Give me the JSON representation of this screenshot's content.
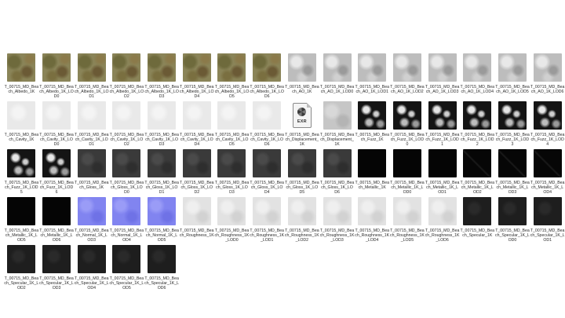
{
  "files": [
    {
      "name": "T_00715_MD_Beach_Albedo_1K",
      "kind": "albedo"
    },
    {
      "name": "T_00715_MD_Beach_Albedo_1K_LOD0",
      "kind": "albedo"
    },
    {
      "name": "T_00715_MD_Beach_Albedo_1K_LOD1",
      "kind": "albedo"
    },
    {
      "name": "T_00715_MD_Beach_Albedo_1K_LOD2",
      "kind": "albedo"
    },
    {
      "name": "T_00715_MD_Beach_Albedo_1K_LOD3",
      "kind": "albedo"
    },
    {
      "name": "T_00715_MD_Beach_Albedo_1K_LOD4",
      "kind": "albedo"
    },
    {
      "name": "T_00715_MD_Beach_Albedo_1K_LOD5",
      "kind": "albedo"
    },
    {
      "name": "T_00715_MD_Beach_Albedo_1K_LOD6",
      "kind": "albedo"
    },
    {
      "name": "T_00715_MD_Beach_AO_1K",
      "kind": "ao"
    },
    {
      "name": "T_00715_MD_Beach_AO_1K_LOD0",
      "kind": "ao"
    },
    {
      "name": "T_00715_MD_Beach_AO_1K_LOD1",
      "kind": "ao"
    },
    {
      "name": "T_00715_MD_Beach_AO_1K_LOD2",
      "kind": "ao"
    },
    {
      "name": "T_00715_MD_Beach_AO_1K_LOD3",
      "kind": "ao"
    },
    {
      "name": "T_00715_MD_Beach_AO_1K_LOD4",
      "kind": "ao"
    },
    {
      "name": "T_00715_MD_Beach_AO_1K_LOD5",
      "kind": "ao"
    },
    {
      "name": "T_00715_MD_Beach_AO_1K_LOD6",
      "kind": "ao"
    },
    {
      "name": "T_00715_MD_Beach_Cavity_1K",
      "kind": "cavity"
    },
    {
      "name": "T_00715_MD_Beach_Cavity_1K_LOD0",
      "kind": "cavity"
    },
    {
      "name": "T_00715_MD_Beach_Cavity_1K_LOD1",
      "kind": "cavity"
    },
    {
      "name": "T_00715_MD_Beach_Cavity_1K_LOD2",
      "kind": "cavity"
    },
    {
      "name": "T_00715_MD_Beach_Cavity_1K_LOD3",
      "kind": "cavity"
    },
    {
      "name": "T_00715_MD_Beach_Cavity_1K_LOD4",
      "kind": "cavity"
    },
    {
      "name": "T_00715_MD_Beach_Cavity_1K_LOD5",
      "kind": "cavity"
    },
    {
      "name": "T_00715_MD_Beach_Cavity_1K_LOD6",
      "kind": "cavity"
    },
    {
      "name": "T_00715_MD_Beach_Displacement_1K",
      "kind": "exr",
      "badge": "EXR"
    },
    {
      "name": "T_00715_MD_Beach_Displacement_1K",
      "kind": "displacement"
    },
    {
      "name": "T_00715_MD_Beach_Fuzz_1K",
      "kind": "fuzz"
    },
    {
      "name": "T_00715_MD_Beach_Fuzz_1K_LOD0",
      "kind": "fuzz"
    },
    {
      "name": "T_00715_MD_Beach_Fuzz_1K_LOD1",
      "kind": "fuzz"
    },
    {
      "name": "T_00715_MD_Beach_Fuzz_1K_LOD2",
      "kind": "fuzz"
    },
    {
      "name": "T_00715_MD_Beach_Fuzz_1K_LOD3",
      "kind": "fuzz"
    },
    {
      "name": "T_00715_MD_Beach_Fuzz_1K_LOD4",
      "kind": "fuzz"
    },
    {
      "name": "T_00715_MD_Beach_Fuzz_1K_LOD5",
      "kind": "fuzz"
    },
    {
      "name": "T_00715_MD_Beach_Fuzz_1K_LOD6",
      "kind": "fuzz"
    },
    {
      "name": "T_00715_MD_Beach_Gloss_1K",
      "kind": "gloss"
    },
    {
      "name": "T_00715_MD_Beach_Gloss_1K_LOD0",
      "kind": "gloss"
    },
    {
      "name": "T_00715_MD_Beach_Gloss_1K_LOD1",
      "kind": "gloss"
    },
    {
      "name": "T_00715_MD_Beach_Gloss_1K_LOD2",
      "kind": "gloss"
    },
    {
      "name": "T_00715_MD_Beach_Gloss_1K_LOD3",
      "kind": "gloss"
    },
    {
      "name": "T_00715_MD_Beach_Gloss_1K_LOD4",
      "kind": "gloss"
    },
    {
      "name": "T_00715_MD_Beach_Gloss_1K_LOD5",
      "kind": "gloss"
    },
    {
      "name": "T_00715_MD_Beach_Gloss_1K_LOD6",
      "kind": "gloss"
    },
    {
      "name": "T_00715_MD_Beach_Metallic_1K",
      "kind": "metallic"
    },
    {
      "name": "T_00715_MD_Beach_Metallic_1K_LOD0",
      "kind": "metallic"
    },
    {
      "name": "T_00715_MD_Beach_Metallic_1K_LOD1",
      "kind": "metallic"
    },
    {
      "name": "T_00715_MD_Beach_Metallic_1K_LOD2",
      "kind": "metallic-wm"
    },
    {
      "name": "T_00715_MD_Beach_Metallic_1K_LOD3",
      "kind": "metallic-wm"
    },
    {
      "name": "T_00715_MD_Beach_Metallic_1K_LOD4",
      "kind": "metallic-wm"
    },
    {
      "name": "T_00715_MD_Beach_Metallic_1K_LOD5",
      "kind": "metallic"
    },
    {
      "name": "T_00715_MD_Beach_Metallic_1K_LOD6",
      "kind": "metallic"
    },
    {
      "name": "T_00715_MD_Beach_Normal_1K_LOD3",
      "kind": "normal"
    },
    {
      "name": "T_00715_MD_Beach_Normal_1K_LOD4",
      "kind": "normal"
    },
    {
      "name": "T_00715_MD_Beach_Normal_1K_LOD5",
      "kind": "normal"
    },
    {
      "name": "T_00715_MD_Beach_Roughness_1K",
      "kind": "roughness"
    },
    {
      "name": "T_00715_MD_Beach_Roughness_1K_LOD0",
      "kind": "roughness"
    },
    {
      "name": "T_00715_MD_Beach_Roughness_1K_LOD1",
      "kind": "roughness"
    },
    {
      "name": "T_00715_MD_Beach_Roughness_1K_LOD2",
      "kind": "roughness"
    },
    {
      "name": "T_00715_MD_Beach_Roughness_1K_LOD3",
      "kind": "roughness"
    },
    {
      "name": "T_00715_MD_Beach_Roughness_1K_LOD4",
      "kind": "roughness"
    },
    {
      "name": "T_00715_MD_Beach_Roughness_1K_LOD5",
      "kind": "roughness"
    },
    {
      "name": "T_00715_MD_Beach_Roughness_1K_LOD6",
      "kind": "roughness"
    },
    {
      "name": "T_00715_MD_Beach_Specular_1K",
      "kind": "specular"
    },
    {
      "name": "T_00715_MD_Beach_Specular_1K_LOD0",
      "kind": "specular"
    },
    {
      "name": "T_00715_MD_Beach_Specular_1K_LOD1",
      "kind": "specular"
    },
    {
      "name": "T_00715_MD_Beach_Specular_1K_LOD2",
      "kind": "specular"
    },
    {
      "name": "T_00715_MD_Beach_Specular_1K_LOD3",
      "kind": "specular"
    },
    {
      "name": "T_00715_MD_Beach_Specular_1K_LOD4",
      "kind": "specular"
    },
    {
      "name": "T_00715_MD_Beach_Specular_1K_LOD5",
      "kind": "specular"
    },
    {
      "name": "T_00715_MD_Beach_Specular_1K_LOD6",
      "kind": "specular"
    }
  ]
}
